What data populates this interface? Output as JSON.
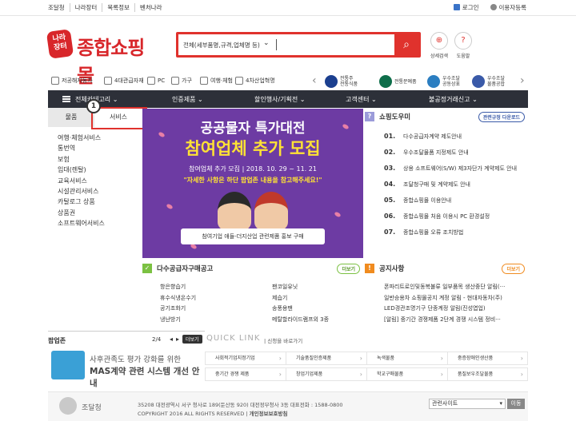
{
  "top_links": [
    "조달청",
    "나라장터",
    "목록정보",
    "벤처나라"
  ],
  "top_right": {
    "login": "로그인",
    "register": "이용자등록"
  },
  "logo": {
    "badge": "나라\n장터",
    "text": "종합쇼핑몰"
  },
  "search": {
    "category": "전체(세부품명,규격,업체명 등)"
  },
  "header_icons": [
    {
      "label": "상세검색",
      "icon": "magnify-icon"
    },
    {
      "label": "도움말",
      "icon": "help-icon"
    }
  ],
  "subnav": [
    "저공해자동차",
    "4대관급자재",
    "PC",
    "가구",
    "여행·체험",
    "4차산업혁명"
  ],
  "certs": [
    {
      "label": "전통주\n전통식품",
      "color": "#1b3f8f"
    },
    {
      "label": "전통문예품",
      "color": "#0e6e4a"
    },
    {
      "label": "우수조달\n공동상표",
      "color": "#2b7ec1"
    },
    {
      "label": "우수조달\n물품공합",
      "color": "#3a5aa8"
    }
  ],
  "mainnav": [
    "전체카테고리",
    "인증제품",
    "할인행사/기획전",
    "고객센터",
    "불공정거래신고"
  ],
  "tabs": {
    "product": "물품",
    "service": "서비스"
  },
  "badge_number": "1",
  "service_items": [
    "여행·체험서비스",
    "통번역",
    "보험",
    "임대(렌탈)",
    "교육서비스",
    "시설관리서비스",
    "카탈로그 상품",
    "상품권",
    "소프트웨어서비스"
  ],
  "banner": {
    "line1": "공공물자 특가대전",
    "line2": "참여업체 추가 모집",
    "line3": "참여업체 추가 모집 | 2018. 10. 29 ~ 11. 21",
    "line4": "\"자세한 사항은 하단 팝업존 내용을 참고해주세요!\"",
    "strip": "참여기업 애들-더지산업 관련제품 홍보 구매"
  },
  "shop_guide": {
    "title": "쇼핑도우미",
    "button": "관련규정 다운로드",
    "items": [
      {
        "no": "01.",
        "text": "다수공급자계약 제도안내"
      },
      {
        "no": "02.",
        "text": "우수조달물품 지정제도 안내"
      },
      {
        "no": "03.",
        "text": "상용 소프트웨어(S/W) 제3자단가 계약제도 안내"
      },
      {
        "no": "04.",
        "text": "조달청구매 및 계약제도 안내"
      },
      {
        "no": "05.",
        "text": "종합쇼핑몰 이용안내"
      },
      {
        "no": "06.",
        "text": "종합쇼핑몰 처음 이용시 PC 환경설정"
      },
      {
        "no": "07.",
        "text": "종합쇼핑몰 오류 조치방법"
      }
    ]
  },
  "mas_notice": {
    "title": "다수공급자구매공고",
    "more": "더보기",
    "left": [
      "항은향습기",
      "휴수식냉온수기",
      "공기조화기",
      "냉난방기"
    ],
    "right": [
      "팬코일유닛",
      "제습기",
      "송풍용팬",
      "메탈할라이드램프외 3종"
    ]
  },
  "notice": {
    "title": "공지사항",
    "more": "더보기",
    "items": [
      "폰파리트로인및동복불류 일부품목 생산중단 알림(···",
      "일반승용차 쇼핑몰공지 계정 알림 - 현대자동차(주)",
      "LED경관조명기구 단종계정 알림(진성엽업)",
      "[알림] 중기간 경쟁제품 2단계 경쟁 시스템 정비···"
    ]
  },
  "popup": {
    "title": "팝업존",
    "page": "2/4",
    "more": "더보기",
    "text1": "사후관족도 평가 강화를 위한",
    "text2": "MAS계약 관련 시스템 개선 안내"
  },
  "quick": {
    "title": "QUICK LINK",
    "subtitle": "| 신청을 바로가기",
    "cells": [
      "사회적기업지정기업",
      "기술품질인증제품",
      "녹색물품",
      "중증장애인생산품",
      "중기간 경쟁 제품",
      "창업기업제품",
      "학교구매물품",
      "품질보우조달물품"
    ]
  },
  "footer": {
    "org": "조달청",
    "addr": "35208 대전광역시 서구 청사로 189(둔산동 920) 대전정부청사 3동 대표전화 : 1588-0800",
    "copy": "COPYRIGHT 2016 ALL RIGHTS RESERVED |",
    "privacy": "개인정보보호방침",
    "select": "관련사이트",
    "go": "이동"
  },
  "colors": {
    "brand_red": "#e0322d",
    "nav_dark": "#2d3039",
    "banner_purple": "#6d3ba3",
    "green": "#7bc142"
  }
}
